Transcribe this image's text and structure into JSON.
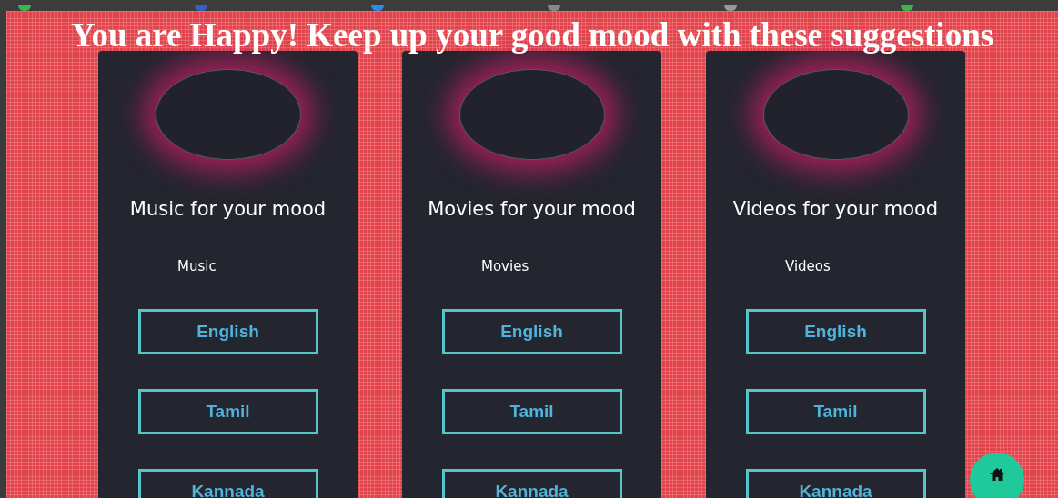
{
  "heading": "You are Happy! Keep up your good mood with these suggestions",
  "cards": [
    {
      "title": "Music for your mood",
      "category": "Music",
      "buttons": [
        "English",
        "Tamil",
        "Kannada"
      ]
    },
    {
      "title": "Movies for your mood",
      "category": "Movies",
      "buttons": [
        "English",
        "Tamil",
        "Kannada"
      ]
    },
    {
      "title": "Videos for your mood",
      "category": "Videos",
      "buttons": [
        "English",
        "Tamil",
        "Kannada"
      ]
    }
  ]
}
